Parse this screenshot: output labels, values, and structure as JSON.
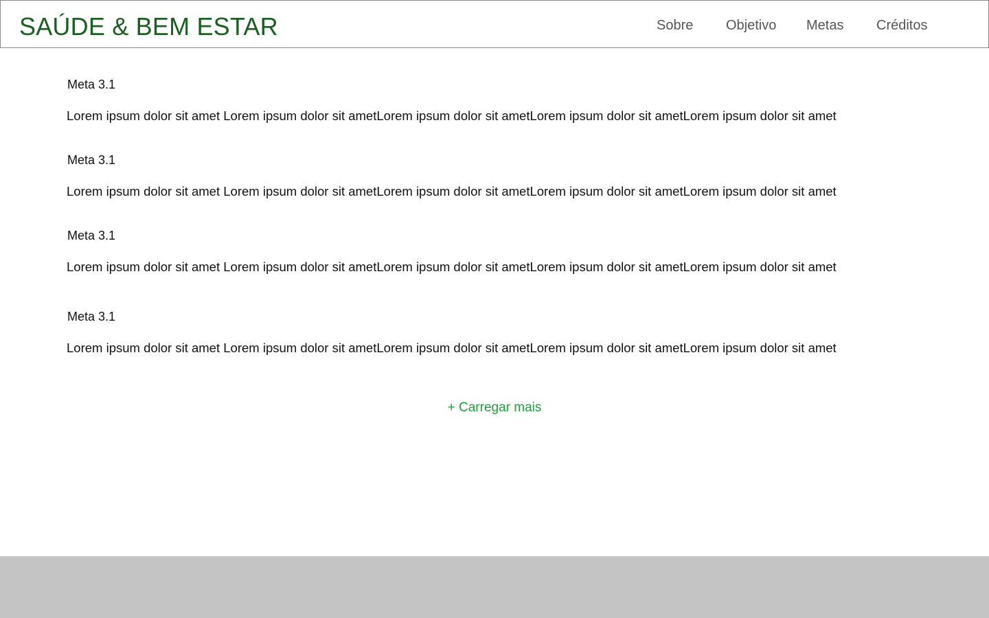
{
  "header": {
    "logo": "SAÚDE & BEM ESTAR",
    "nav": [
      "Sobre",
      "Objetivo",
      "Metas",
      "Créditos"
    ]
  },
  "goals": [
    {
      "title": "Meta 3.1",
      "text": "Lorem ipsum dolor sit amet Lorem ipsum dolor sit ametLorem ipsum dolor sit ametLorem ipsum dolor sit ametLorem ipsum dolor sit amet"
    },
    {
      "title": "Meta 3.1",
      "text": "Lorem ipsum dolor sit amet Lorem ipsum dolor sit ametLorem ipsum dolor sit ametLorem ipsum dolor sit ametLorem ipsum dolor sit amet"
    },
    {
      "title": "Meta 3.1",
      "text": "Lorem ipsum dolor sit amet Lorem ipsum dolor sit ametLorem ipsum dolor sit ametLorem ipsum dolor sit ametLorem ipsum dolor sit amet"
    },
    {
      "title": "Meta 3.1",
      "text": "Lorem ipsum dolor sit amet Lorem ipsum dolor sit ametLorem ipsum dolor sit ametLorem ipsum dolor sit ametLorem ipsum dolor sit amet"
    }
  ],
  "load_more": "+ Carregar mais",
  "colors": {
    "brand": "#1b5e20",
    "accent": "#1e9e3c",
    "nav_text": "#555555",
    "footer_bg": "#c4c4c4"
  }
}
